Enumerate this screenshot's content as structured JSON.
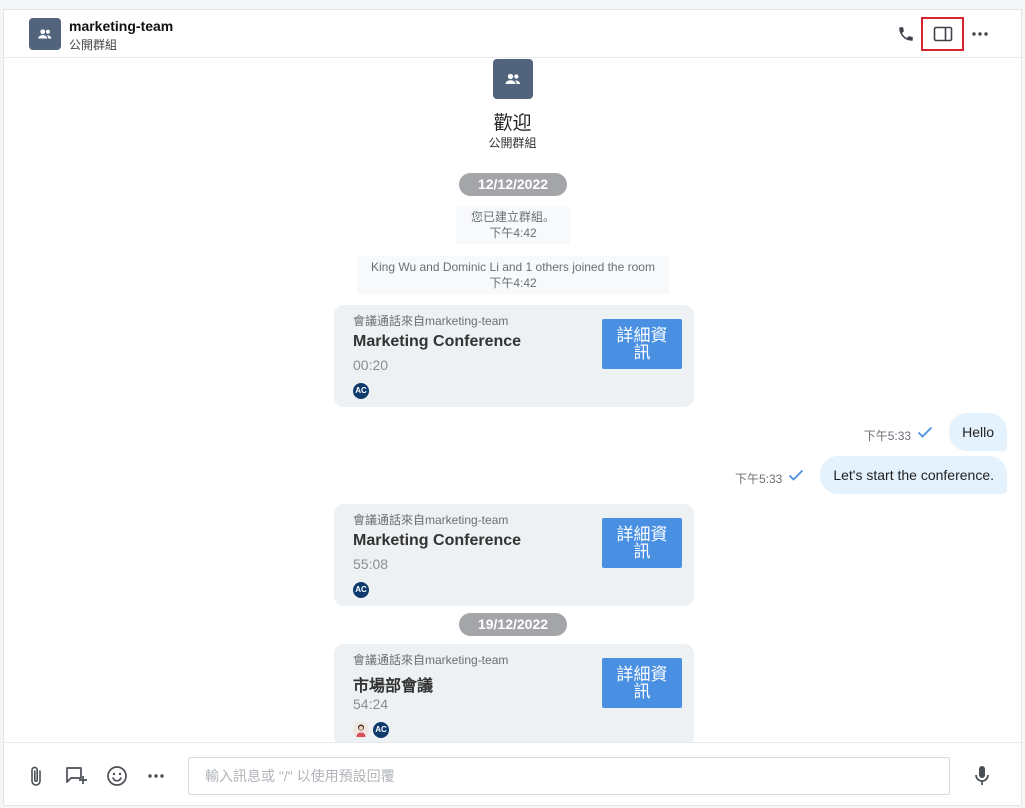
{
  "header": {
    "title": "marketing-team",
    "subtitle": "公開群組"
  },
  "welcome": {
    "title": "歡迎",
    "subtitle": "公開群組"
  },
  "dates": [
    "12/12/2022",
    "19/12/2022"
  ],
  "system_messages": [
    {
      "text": "您已建立群組。",
      "time": "下午4:42"
    },
    {
      "text": "King Wu and Dominic Li and 1 others joined the room",
      "time": "下午4:42"
    }
  ],
  "call_cards": [
    {
      "from": "會議通話來自marketing-team",
      "title": "Marketing Conference",
      "duration": "00:20",
      "button": "詳細資訊",
      "participants": [
        "AC"
      ]
    },
    {
      "from": "會議通話來自marketing-team",
      "title": "Marketing Conference",
      "duration": "55:08",
      "button": "詳細資訊",
      "participants": [
        "AC"
      ]
    },
    {
      "from": "會議通話來自marketing-team",
      "title": "市場部會議",
      "duration": "54:24",
      "button": "詳細資訊",
      "participants": [
        "photo",
        "AC"
      ]
    }
  ],
  "outgoing": [
    {
      "time": "下午5:33",
      "text": "Hello"
    },
    {
      "time": "下午5:33",
      "text": "Let's start the conference."
    }
  ],
  "composer": {
    "placeholder": "輸入訊息或 \"/\" 以使用預設回覆"
  },
  "colors": {
    "accent": "#4a90e2",
    "avatar": "#52637c",
    "bubble": "#e3f2fd",
    "highlight": "#d8232a"
  }
}
